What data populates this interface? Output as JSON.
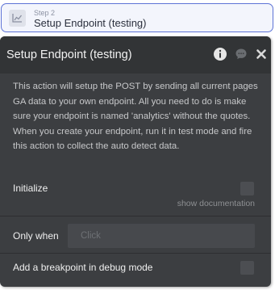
{
  "step": {
    "number": "Step 2",
    "title": "Setup Endpoint (testing)",
    "icon": "line-chart-icon"
  },
  "panel": {
    "title": "Setup Endpoint (testing)",
    "icons": [
      "info-icon",
      "comment-icon",
      "close-icon"
    ],
    "description": "This action will setup the POST by sending all current pages GA data to your own endpoint. All you need to do is make sure your endpoint is named 'analytics' without the quotes. When you create your endpoint, run it in test mode and fire this action to collect the auto detect data.",
    "initialize_label": "Initialize",
    "show_documentation": "show documentation",
    "only_when_label": "Only when",
    "only_when_placeholder": "Click",
    "breakpoint_label": "Add a breakpoint in debug mode"
  },
  "colors": {
    "accent": "#5d73d6",
    "panel_bg": "#3c3e41",
    "header_bg": "#323436"
  }
}
